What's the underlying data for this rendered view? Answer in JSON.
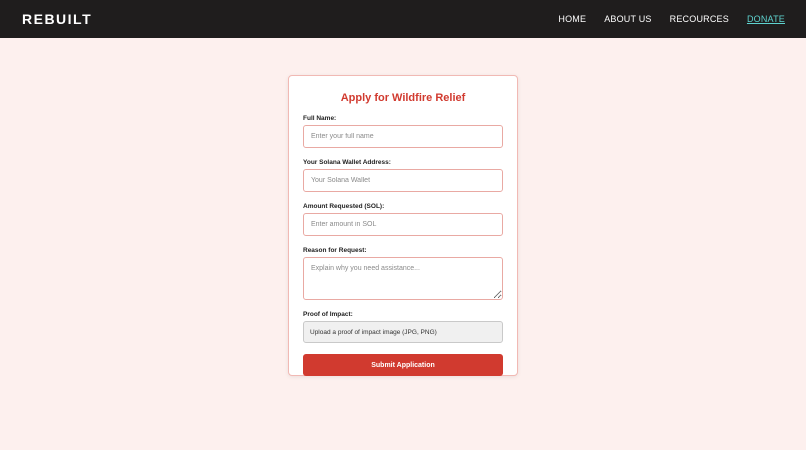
{
  "nav": {
    "logo": "REBUILT",
    "links": [
      "HOME",
      "ABOUT US",
      "RECOURCES",
      "DONATE"
    ]
  },
  "form": {
    "title": "Apply for Wildfire Relief",
    "full_name": {
      "label": "Full Name:",
      "placeholder": "Enter your full name"
    },
    "wallet": {
      "label": "Your Solana Wallet Address:",
      "placeholder": "Your Solana Wallet"
    },
    "amount": {
      "label": "Amount Requested (SOL):",
      "placeholder": "Enter amount in SOL"
    },
    "reason": {
      "label": "Reason for Request:",
      "placeholder": "Explain why you need assistance..."
    },
    "proof": {
      "label": "Proof of Impact:",
      "upload_text": "Upload a proof of impact image (JPG, PNG)"
    },
    "submit_label": "Submit Application"
  },
  "colors": {
    "navbar_bg": "#1f1d1d",
    "page_bg": "#fdf0ee",
    "accent_red": "#d13a2f",
    "active_link": "#5ed3cf"
  }
}
